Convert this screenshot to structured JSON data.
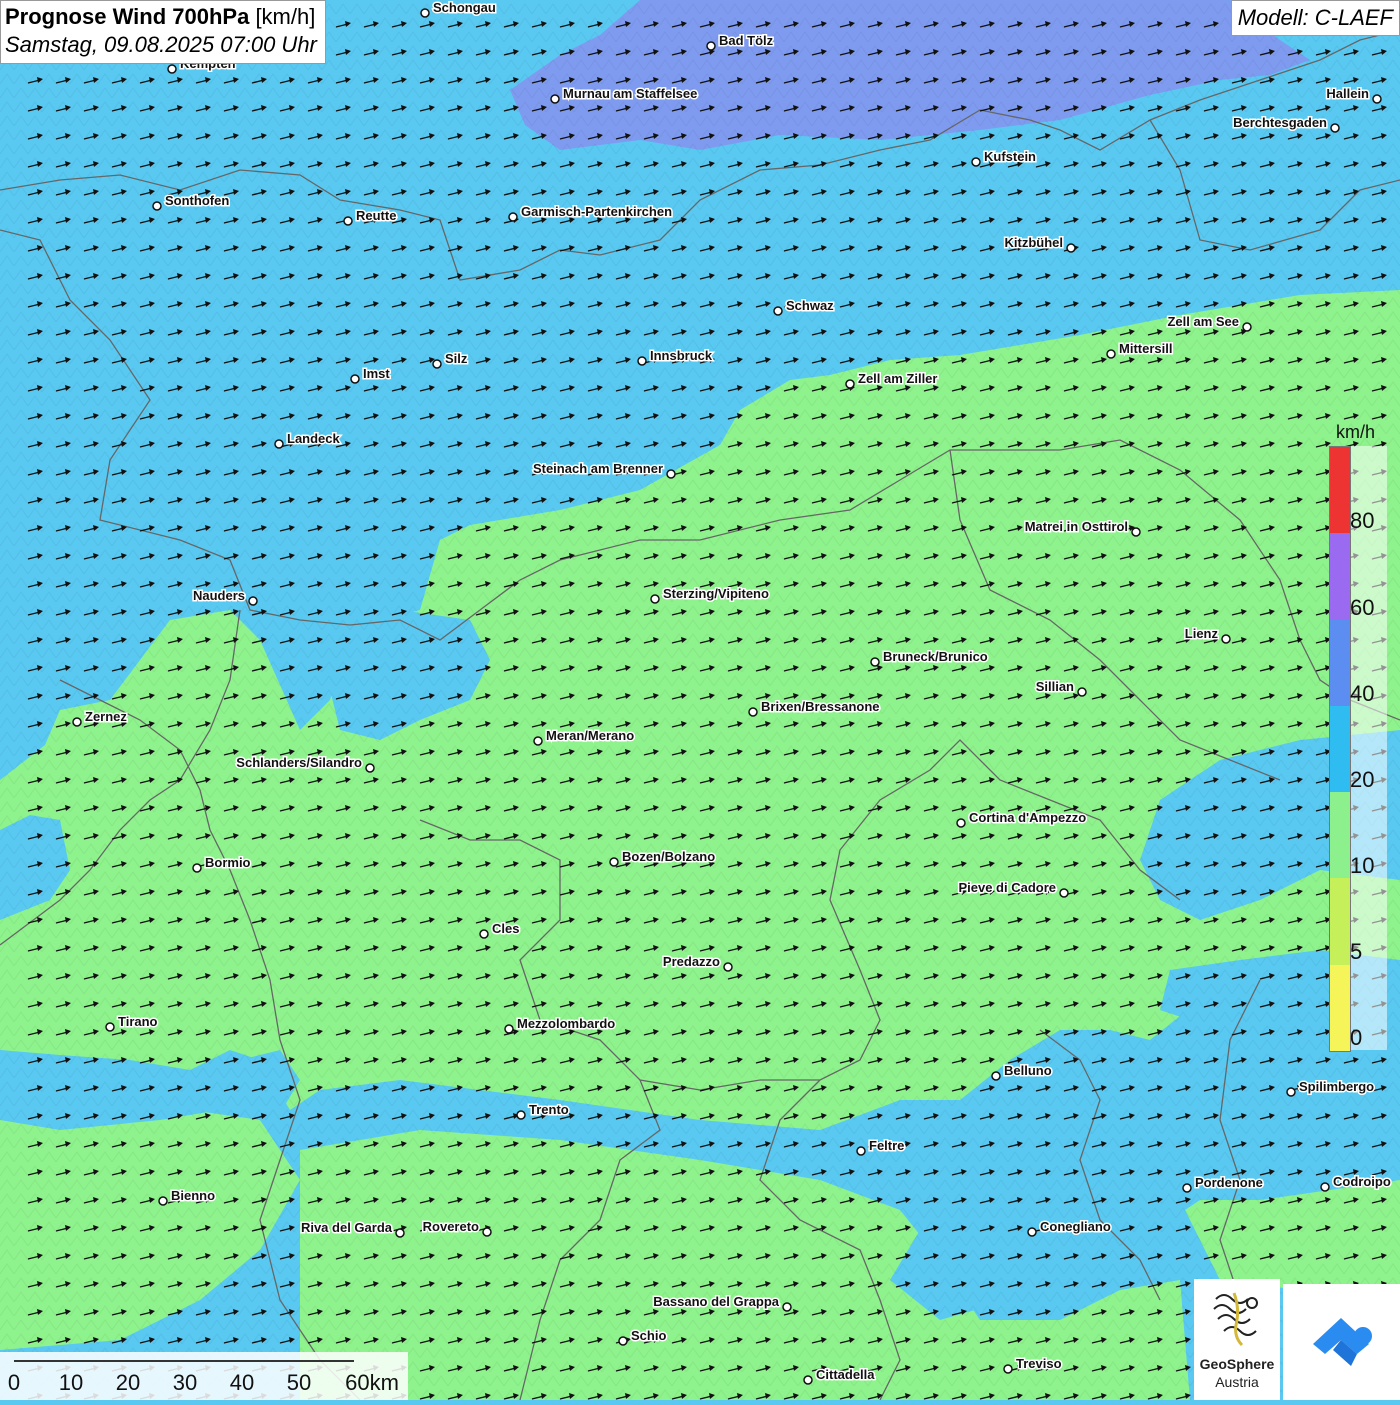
{
  "title": {
    "main_bold": "Prognose Wind 700hPa",
    "main_unit": "[km/h]",
    "subtitle": "Samstag, 09.08.2025 07:00 Uhr"
  },
  "model": "Modell: C-LAEF",
  "legend": {
    "unit": "km/h",
    "ticks": [
      "80",
      "60",
      "40",
      "20",
      "10",
      "5",
      "0"
    ],
    "colors": [
      "#ee3333",
      "#9a6af0",
      "#5b8ef0",
      "#2fbcf0",
      "#8cf08c",
      "#c6f05a",
      "#f5f55a"
    ]
  },
  "scale": {
    "labels": [
      "0",
      "10",
      "20",
      "30",
      "40",
      "50",
      "60km"
    ]
  },
  "logo": {
    "name": "GeoSphere",
    "sub": "Austria"
  },
  "map_colors": {
    "wind_20_40": "#59c9f2",
    "wind_10_20": "#8ef38c",
    "wind_40_60": "#7f9bf0",
    "border": "#666666",
    "arrow": "#111111"
  },
  "cities": [
    "Schongau",
    "Bad Tölz",
    "Kempten",
    "Murnau am Staffelsee",
    "Hallein",
    "Berchtesgaden",
    "Kufstein",
    "Sonthofen",
    "Reutte",
    "Garmisch-Partenkirchen",
    "Kitzbühel",
    "Schwaz",
    "Zell am See",
    "Mittersill",
    "Innsbruck",
    "Silz",
    "Imst",
    "Zell am Ziller",
    "Landeck",
    "Steinach am Brenner",
    "Matrei in Osttirol",
    "Nauders",
    "Sterzing/Vipiteno",
    "Lienz",
    "Bruneck/Brunico",
    "Sillian",
    "Brixen/Bressanone",
    "Zernez",
    "Meran/Merano",
    "Schlanders/Silandro",
    "Cortina d'Ampezzo",
    "Bozen/Bolzano",
    "Bormio",
    "Pieve di Cadore",
    "Cles",
    "Predazzo",
    "Tirano",
    "Mezzolombardo",
    "Belluno",
    "Spilimbergo",
    "Trento",
    "Feltre",
    "Pordenone",
    "Codroipo",
    "Bienno",
    "Riva del Garda",
    "Rovereto",
    "Conegliano",
    "Bassano del Grappa",
    "Schio",
    "Treviso",
    "Cittadella"
  ]
}
